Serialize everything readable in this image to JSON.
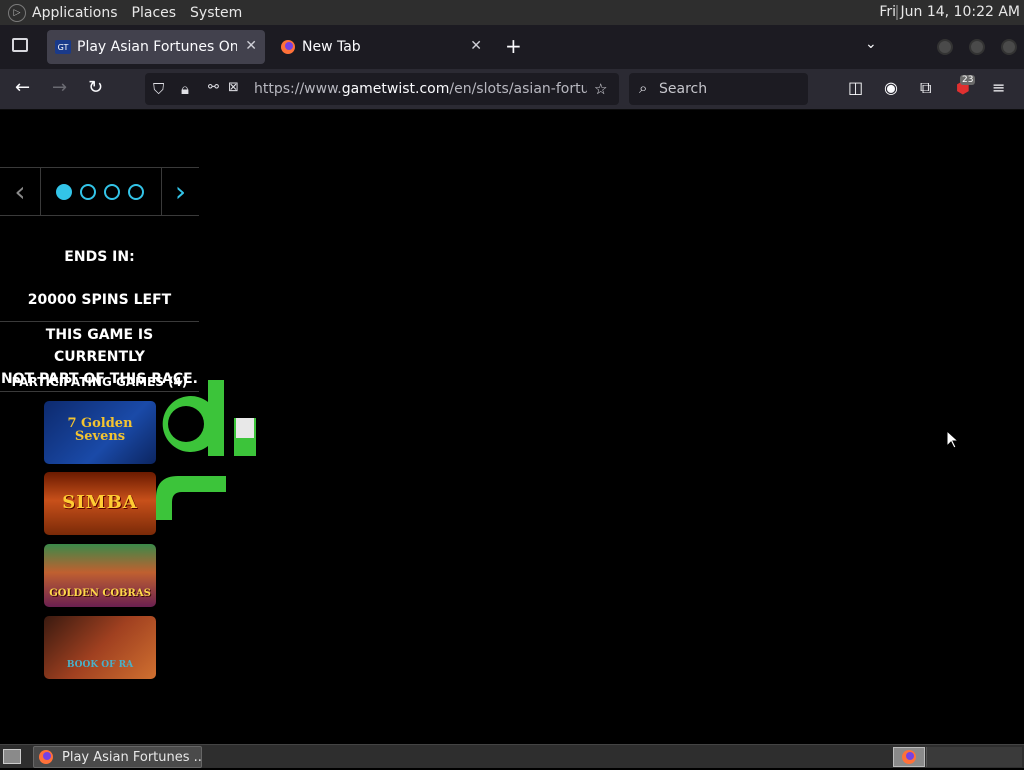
{
  "top_panel": {
    "menus": [
      "Applications",
      "Places",
      "System"
    ],
    "clock": "Fri Jun 14, 10:22 AM"
  },
  "tabs": [
    {
      "title": "Play Asian Fortunes Online F",
      "active": true
    },
    {
      "title": "New Tab",
      "active": false
    }
  ],
  "navbar": {
    "url_prefix": "https://www.",
    "url_domain": "gametwist.com",
    "url_path": "/en/slots/asian-fortunes/",
    "search_placeholder": "Search",
    "extension_badge": "23"
  },
  "page": {
    "ends_in": "ENDS IN:",
    "spins_left": "20000 SPINS LEFT",
    "not_part_line1": "THIS GAME IS CURRENTLY",
    "not_part_line2": "NOT PART OF THIS RACE.",
    "participating": "PARTICIPATING GAMES (4)",
    "carousel_dots": 4,
    "carousel_active": 1,
    "games": [
      {
        "name": "Golden Sevens",
        "label": "7 Golden Sevens"
      },
      {
        "name": "Simba",
        "label": "SIMBA"
      },
      {
        "name": "Golden Cobras",
        "label": "GOLDEN COBRAS"
      },
      {
        "name": "Book of Ra",
        "label": "BOOK OF RA"
      }
    ]
  },
  "bottom_panel": {
    "taskbar_item": "Play Asian Fortunes ..."
  },
  "colors": {
    "accent": "#33c4e8",
    "logo_green": "#3cc43a",
    "page_bg": "#000000"
  }
}
